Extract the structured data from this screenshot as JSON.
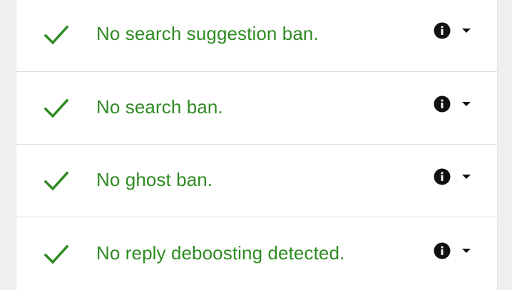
{
  "colors": {
    "success_green": "#2e8b22",
    "icon_dark": "#111111"
  },
  "checks": [
    {
      "label": "No search suggestion ban.",
      "status_icon": "checkmark-icon",
      "info_icon": "info-icon",
      "expand_icon": "caret-down-icon"
    },
    {
      "label": "No search ban.",
      "status_icon": "checkmark-icon",
      "info_icon": "info-icon",
      "expand_icon": "caret-down-icon"
    },
    {
      "label": "No ghost ban.",
      "status_icon": "checkmark-icon",
      "info_icon": "info-icon",
      "expand_icon": "caret-down-icon"
    },
    {
      "label": "No reply deboosting detected.",
      "status_icon": "checkmark-icon",
      "info_icon": "info-icon",
      "expand_icon": "caret-down-icon"
    }
  ]
}
